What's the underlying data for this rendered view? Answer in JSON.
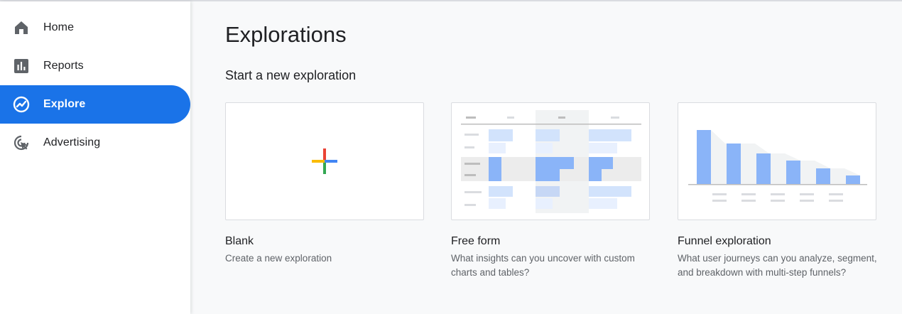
{
  "sidebar": {
    "items": [
      {
        "label": "Home",
        "icon": "home-icon",
        "active": false
      },
      {
        "label": "Reports",
        "icon": "reports-icon",
        "active": false
      },
      {
        "label": "Explore",
        "icon": "explore-icon",
        "active": true
      },
      {
        "label": "Advertising",
        "icon": "advertising-icon",
        "active": false
      }
    ]
  },
  "main": {
    "title": "Explorations",
    "section_title": "Start a new exploration",
    "cards": [
      {
        "title": "Blank",
        "description": "Create a new exploration",
        "thumbnail": "blank-plus-icon"
      },
      {
        "title": "Free form",
        "description": "What insights can you uncover with custom charts and tables?",
        "thumbnail": "free-form-table-thumbnail"
      },
      {
        "title": "Funnel exploration",
        "description": "What user journeys can you analyze, segment, and breakdown with multi-step funnels?",
        "thumbnail": "funnel-chart-thumbnail"
      }
    ]
  },
  "colors": {
    "accent": "#1a73e8",
    "sidebar_icon": "#5f6368",
    "google_red": "#ea4335",
    "google_yellow": "#fbbc04",
    "google_green": "#34a853",
    "google_blue": "#4285f4",
    "thumb_bar": "#8ab4f8",
    "thumb_bar_light": "#d2e3fc"
  }
}
